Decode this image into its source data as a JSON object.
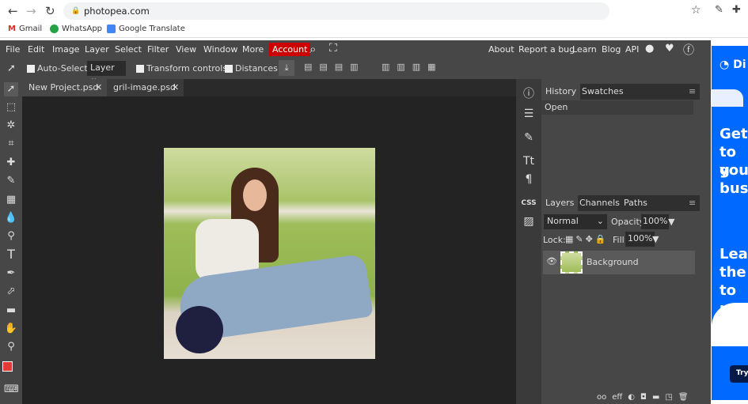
{
  "browser": {
    "url": "photopea.com",
    "bookmarks": [
      "Gmail",
      "WhatsApp",
      "Google Translate"
    ]
  },
  "menu": {
    "items": [
      "File",
      "Edit",
      "Image",
      "Layer",
      "Select",
      "Filter",
      "View",
      "Window",
      "More"
    ],
    "account": "Account",
    "right_links": [
      "About",
      "Report a bug",
      "Learn",
      "Blog",
      "API"
    ]
  },
  "options": {
    "auto_select": "Auto-Select",
    "select_value": "Layer",
    "transform": "Transform controls",
    "distances": "Distances"
  },
  "tabs": [
    {
      "label": "New Project.psd"
    },
    {
      "label": "gril-image.psd"
    }
  ],
  "history": {
    "tabs": [
      "History",
      "Swatches"
    ],
    "items": [
      "Open"
    ]
  },
  "layers": {
    "tabs": [
      "Layers",
      "Channels",
      "Paths"
    ],
    "blend": "Normal",
    "opacity_label": "Opacity:",
    "opacity": "100%",
    "lock_label": "Lock:",
    "fill_label": "Fill:",
    "fill": "100%",
    "items": [
      {
        "name": "Background"
      }
    ],
    "footer": [
      "oo",
      "eff"
    ]
  },
  "right_icons": {
    "css": "CSS"
  },
  "ad": {
    "lines1": [
      "Get",
      "to g",
      "you",
      "bus"
    ],
    "lines2": [
      "Leav",
      "the",
      "to u"
    ],
    "button": "Try",
    "brand": "Di"
  },
  "colors": {
    "foreground": "#e53935",
    "background": "#000000",
    "accent": "#cc0000",
    "ad": "#0069ff"
  }
}
